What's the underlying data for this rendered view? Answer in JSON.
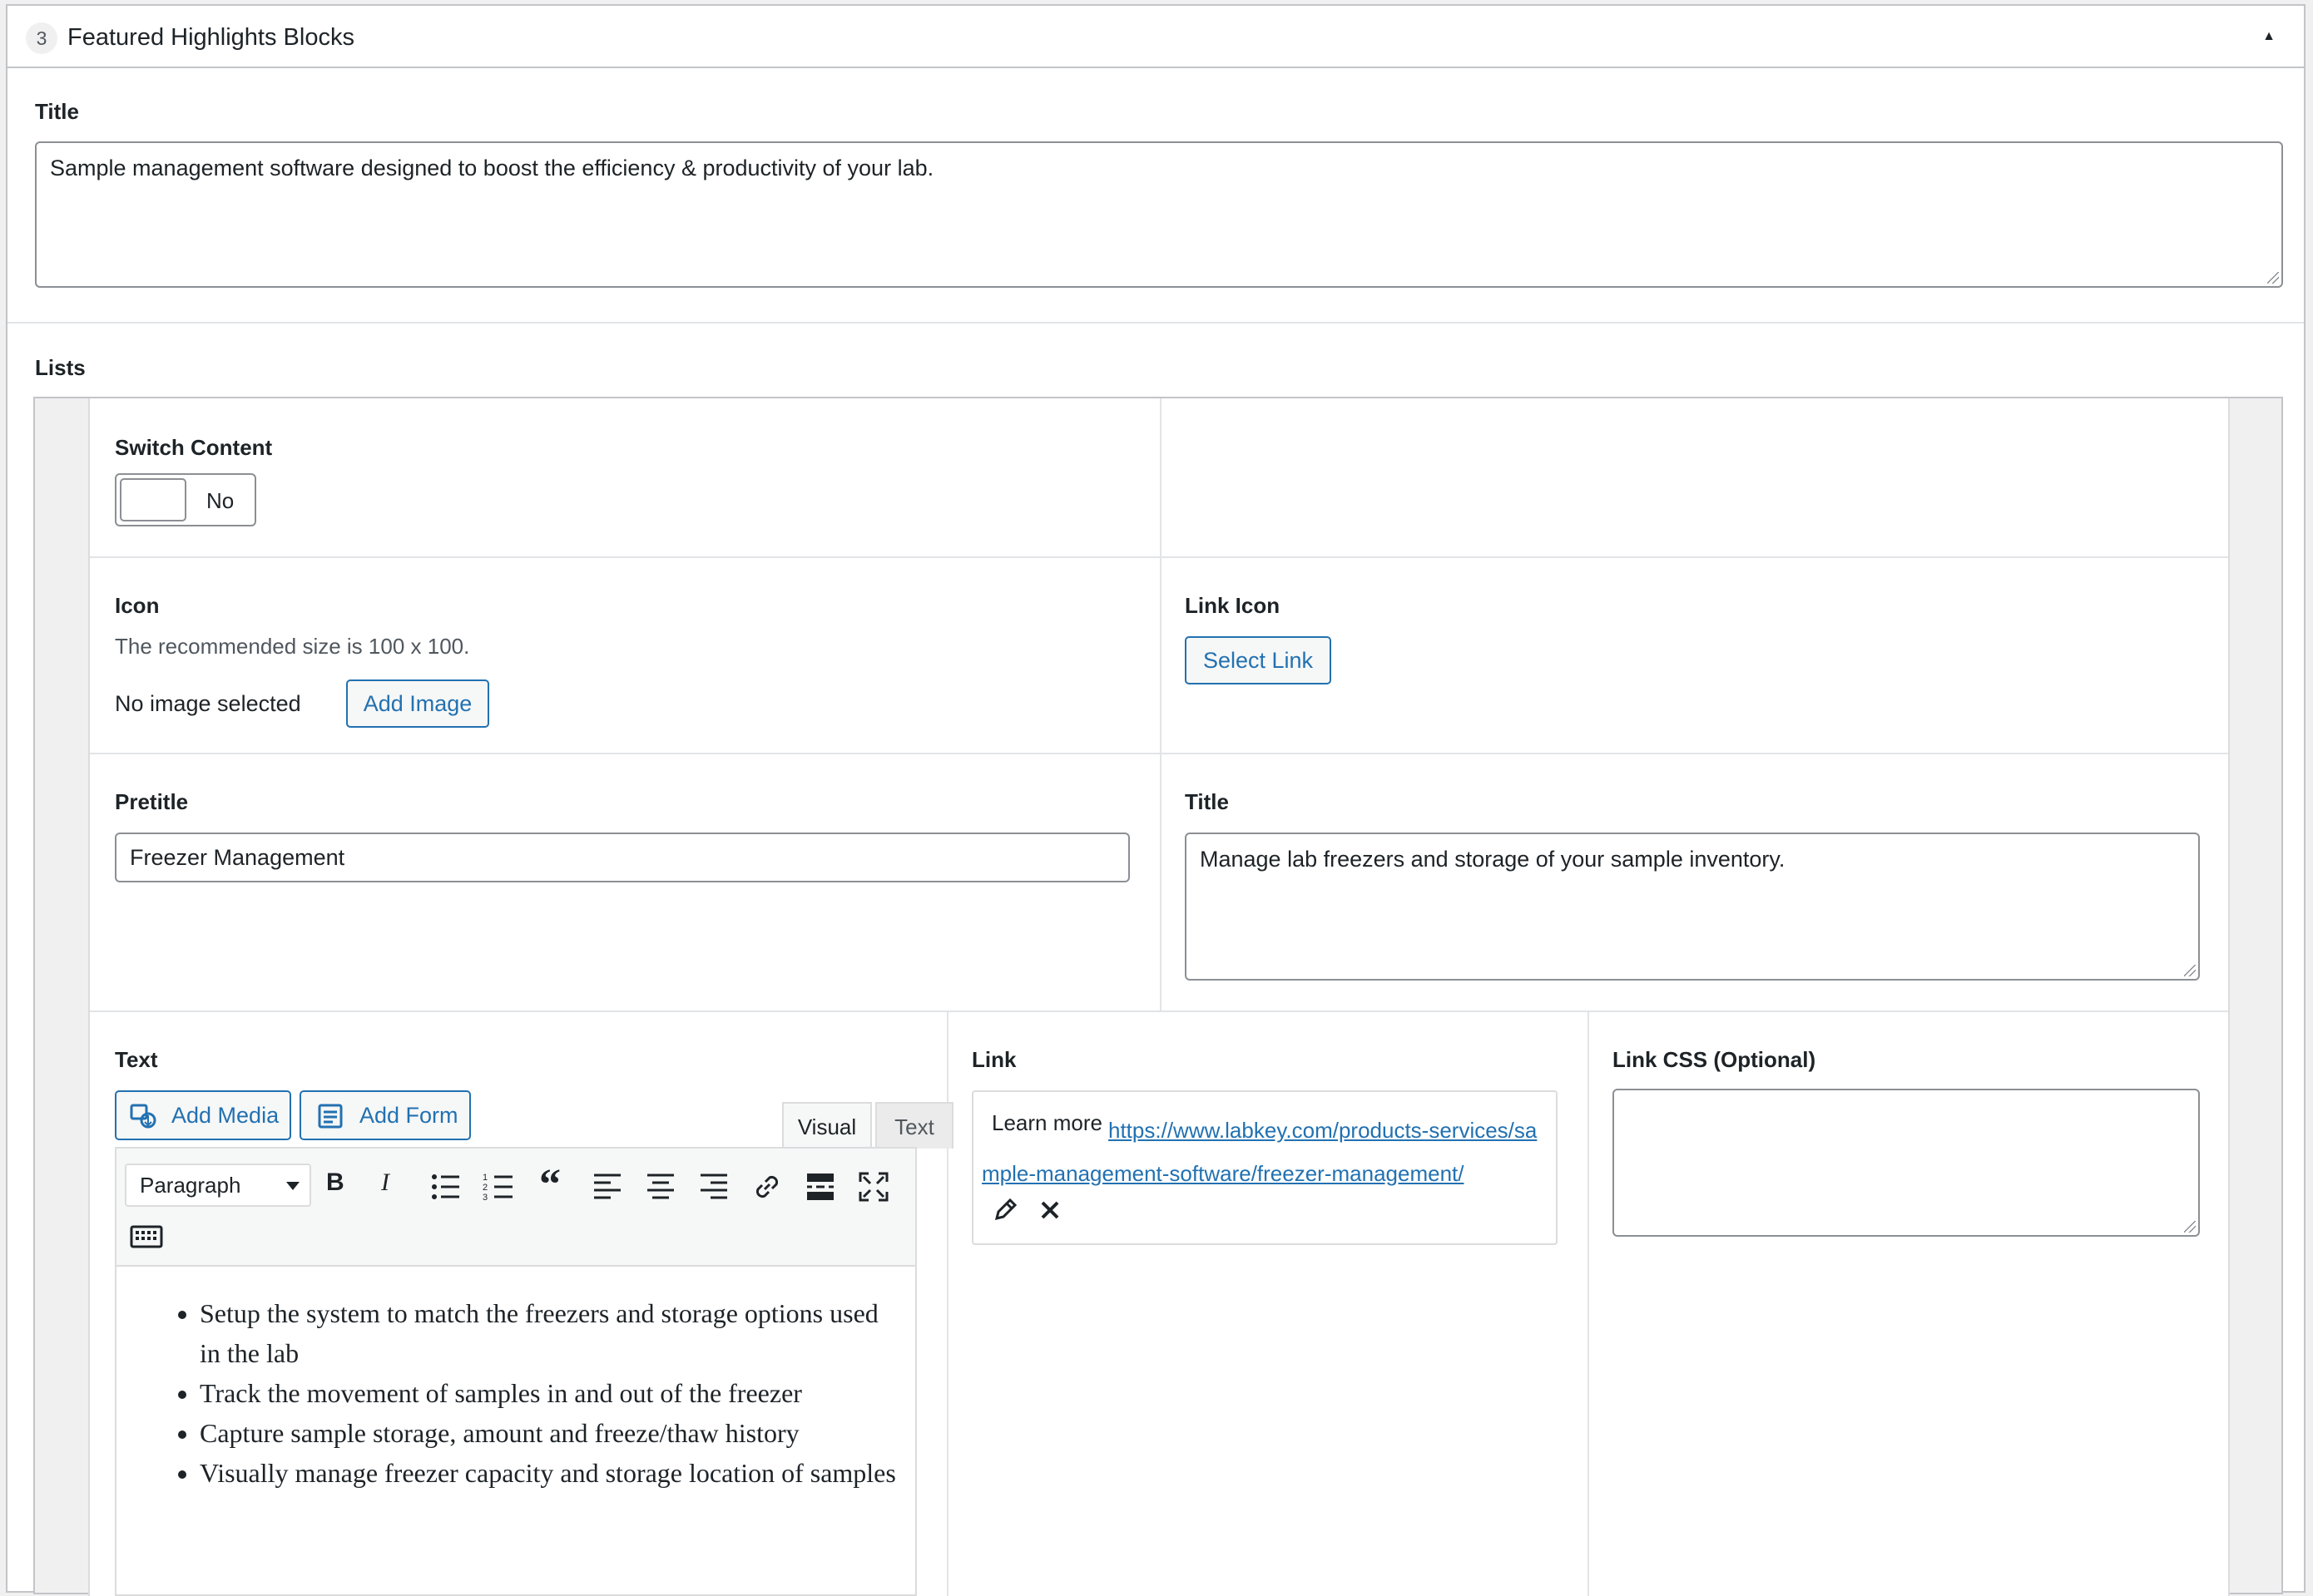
{
  "section": {
    "number": "3",
    "title": "Featured Highlights Blocks"
  },
  "title_field": {
    "label": "Title",
    "value": "Sample management software designed to boost the efficiency & productivity of your lab."
  },
  "lists": {
    "label": "Lists",
    "switch_content": {
      "label": "Switch Content",
      "value": "No"
    },
    "icon": {
      "label": "Icon",
      "description": "The recommended size is 100 x 100.",
      "status": "No image selected",
      "button": "Add Image"
    },
    "link_icon": {
      "label": "Link Icon",
      "button": "Select Link"
    },
    "pretitle": {
      "label": "Pretitle",
      "value": "Freezer Management"
    },
    "item_title": {
      "label": "Title",
      "value": "Manage lab freezers and storage of your sample inventory."
    },
    "text": {
      "label": "Text",
      "add_media": "Add Media",
      "add_form": "Add Form",
      "tabs": [
        "Visual",
        "Text"
      ],
      "format": "Paragraph",
      "bullets": [
        "Setup the system to match the freezers and storage options used in the lab",
        "Track the movement of samples in and out of the freezer",
        "Capture sample storage, amount and freeze/thaw history",
        "Visually manage freezer capacity and storage location of samples"
      ]
    },
    "link": {
      "label": "Link",
      "text": "Learn more",
      "url": "https://www.labkey.com/products-services/sample-management-software/freezer-management/"
    },
    "link_css": {
      "label": "Link CSS (Optional)",
      "value": ""
    }
  },
  "colors": {
    "accent": "#2271b1",
    "border": "#8c8f94",
    "text": "#1d2327",
    "muted": "#50575e"
  }
}
